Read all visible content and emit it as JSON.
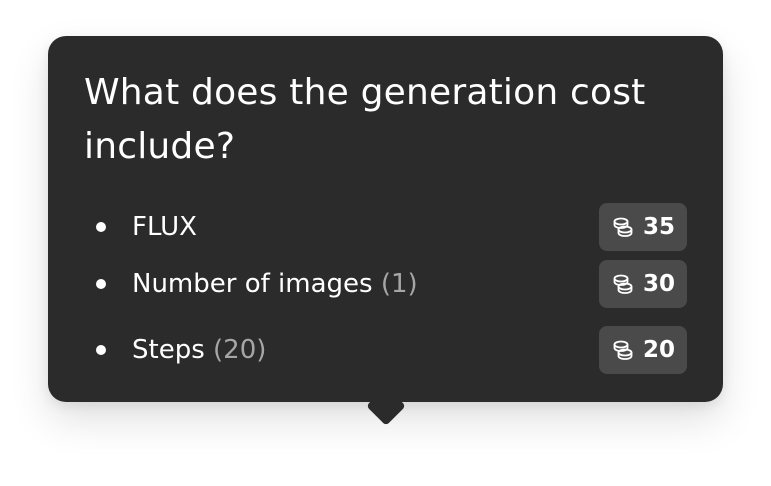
{
  "tooltip": {
    "title": "What does the generation cost include?",
    "items": [
      {
        "label": "FLUX",
        "detail": "",
        "cost": "35",
        "icon": "coins-icon"
      },
      {
        "label": "Number of images ",
        "detail": "(1)",
        "cost": "30",
        "icon": "coins-icon"
      },
      {
        "label": "Steps ",
        "detail": "(20)",
        "cost": "20",
        "icon": "coins-icon"
      }
    ]
  },
  "colors": {
    "background": "#2b2b2b",
    "badge": "#4a4a4a",
    "text": "#ffffff",
    "muted": "#a6a6a6"
  }
}
